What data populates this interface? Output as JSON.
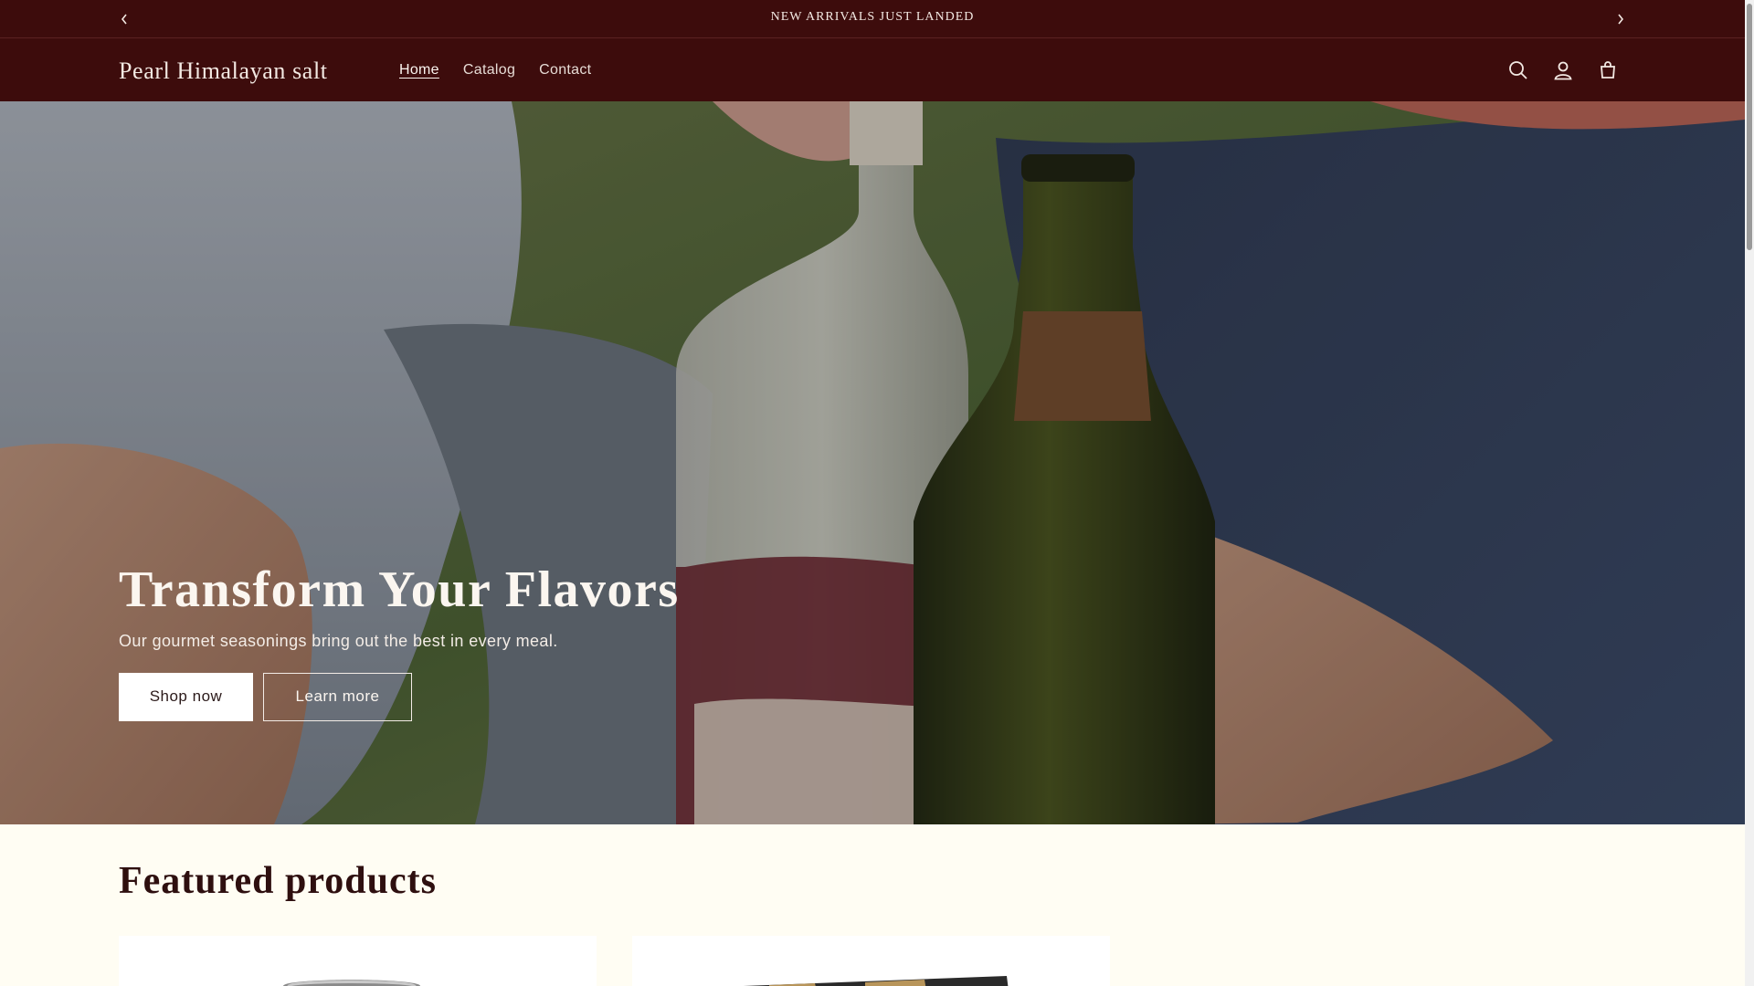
{
  "announcement": {
    "message": "NEW ARRIVALS JUST LANDED",
    "prev_icon": "chevron-left-icon",
    "next_icon": "chevron-right-icon"
  },
  "header": {
    "logo": "Pearl Himalayan salt",
    "nav": [
      {
        "label": "Home",
        "active": true
      },
      {
        "label": "Catalog",
        "active": false
      },
      {
        "label": "Contact",
        "active": false
      }
    ],
    "icons": [
      "search-icon",
      "account-icon",
      "cart-icon"
    ]
  },
  "hero": {
    "title": "Transform Your Flavors",
    "subtitle": "Our gourmet seasonings bring out the best in every meal.",
    "primary_button": "Shop now",
    "secondary_button": "Learn more"
  },
  "featured": {
    "title": "Featured products"
  },
  "colors": {
    "header_bg": "#3d0c0c",
    "page_bg": "#fffdf3",
    "heading": "#2e0f0f"
  }
}
